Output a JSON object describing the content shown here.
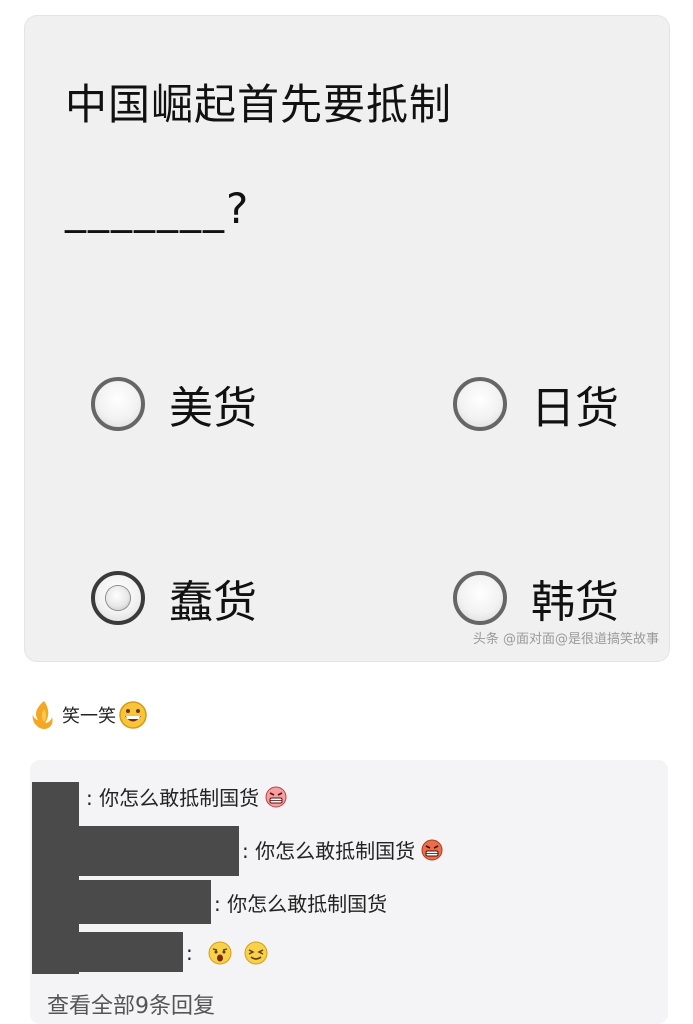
{
  "quiz": {
    "question": "中国崛起首先要抵制",
    "blank": "_______?",
    "options": [
      {
        "label": "美货",
        "checked": false
      },
      {
        "label": "日货",
        "checked": false
      },
      {
        "label": "蠢货",
        "checked": true
      },
      {
        "label": "韩货",
        "checked": false
      }
    ],
    "watermark": "头条 @面对面@是很道搞笑故事"
  },
  "post": {
    "caption": "笑一笑"
  },
  "replies": [
    {
      "text": ": 你怎么敢抵制国货"
    },
    {
      "text": ": 你怎么敢抵制国货"
    },
    {
      "text": ": 你怎么敢抵制国货"
    },
    {
      "text": ":"
    }
  ],
  "view_all": "查看全部9条回复",
  "colors": {
    "card_bg": "#f0f0f0",
    "reply_bg": "#f4f4f6",
    "redaction": "#4a4a4a",
    "link_text": "#555555"
  }
}
